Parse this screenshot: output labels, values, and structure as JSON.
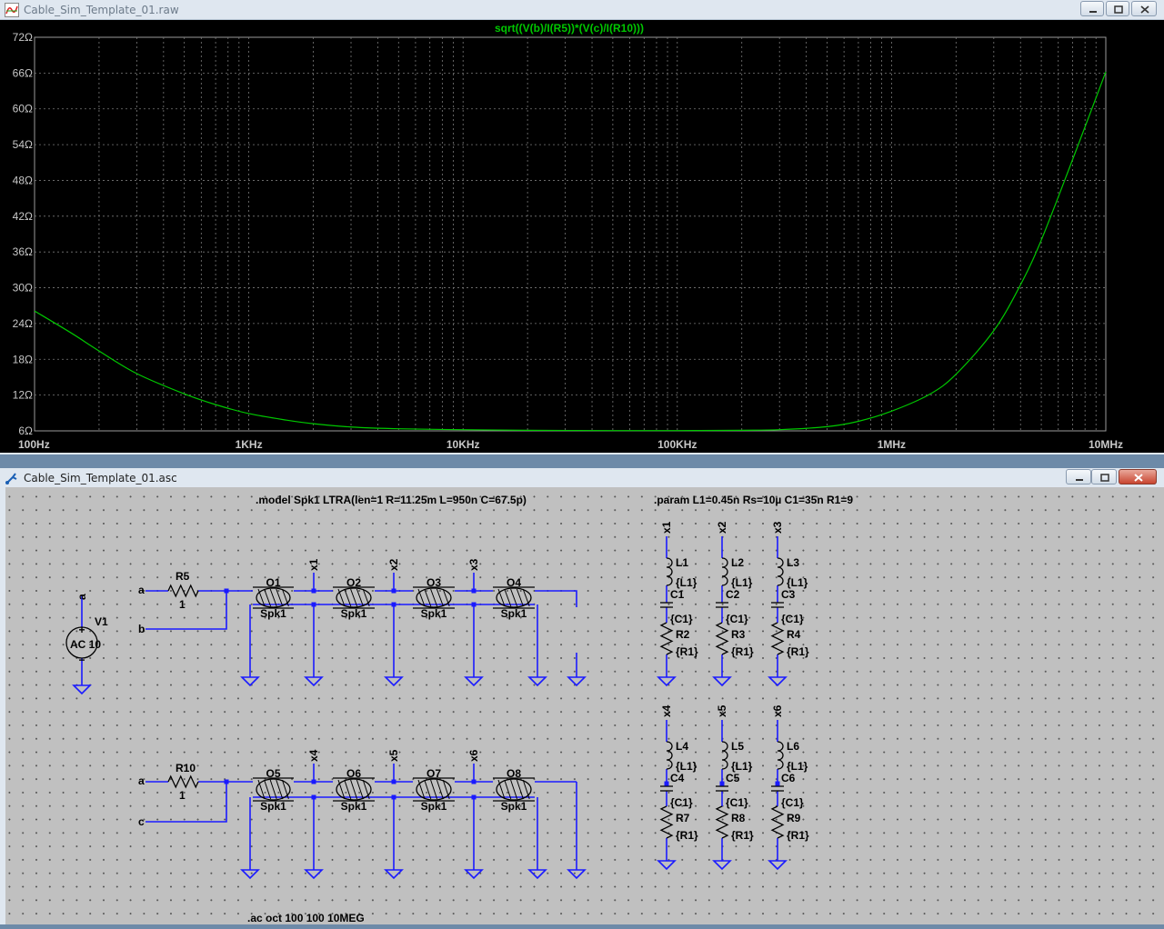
{
  "plot_window": {
    "title": "Cable_Sim_Template_01.raw"
  },
  "schematic_window": {
    "title": "Cable_Sim_Template_01.asc"
  },
  "chart_data": {
    "type": "line",
    "title": "sqrt((V(b)/I(R5))*(V(c)/I(R10)))",
    "x_scale": "log",
    "xlim": [
      100,
      10000000
    ],
    "ylim": [
      6,
      72
    ],
    "x_tick_labels": [
      "100Hz",
      "1KHz",
      "10KHz",
      "100KHz",
      "1MHz",
      "10MHz"
    ],
    "x_ticks": [
      100,
      1000,
      10000,
      100000,
      1000000,
      10000000
    ],
    "y_tick_labels": [
      "6Ω",
      "12Ω",
      "18Ω",
      "24Ω",
      "30Ω",
      "36Ω",
      "42Ω",
      "48Ω",
      "54Ω",
      "60Ω",
      "66Ω",
      "72Ω"
    ],
    "y_ticks": [
      6,
      12,
      18,
      24,
      30,
      36,
      42,
      48,
      54,
      60,
      66,
      72
    ],
    "grid": true,
    "background": "#000000",
    "trace_color": "#00c800",
    "series": [
      {
        "x": [
          100,
          150,
          200,
          300,
          500,
          700,
          1000,
          1500,
          2000,
          3000,
          5000,
          10000,
          20000,
          50000,
          100000,
          200000,
          300000,
          500000,
          700000,
          1000000,
          1500000,
          2000000,
          3000000,
          4000000,
          5000000,
          7000000,
          10000000
        ],
        "values": [
          26.1,
          22.3,
          19.4,
          15.6,
          12.2,
          10.4,
          8.9,
          7.8,
          7.2,
          6.65,
          6.35,
          6.2,
          6.1,
          6.05,
          6.05,
          6.1,
          6.2,
          6.7,
          7.6,
          9.3,
          12.1,
          15.5,
          22.8,
          30.5,
          38.0,
          51.5,
          66.2
        ]
      }
    ]
  },
  "schematic": {
    "model_directive": ".model Spk1 LTRA(len=1 R=11.25m L=950n C=67.5p)",
    "param_directive": ".param L1=0.45n Rs=10µ C1=35n R1=9",
    "ac_directive": ".ac oct 100 100 10MEG",
    "source": {
      "name": "V1",
      "value": "AC 10",
      "net": "a"
    },
    "resistor_top": {
      "name": "R5",
      "value": "1"
    },
    "resistor_bottom": {
      "name": "R10",
      "value": "1"
    },
    "net_labels": {
      "a": "a",
      "b": "b",
      "c": "c"
    },
    "lines_top": [
      "O1",
      "O2",
      "O3",
      "O4"
    ],
    "lines_bottom": [
      "O5",
      "O6",
      "O7",
      "O8"
    ],
    "line_model": "Spk1",
    "tap_labels_top": [
      "x1",
      "x2",
      "x3"
    ],
    "tap_labels_bottom": [
      "x4",
      "x5",
      "x6"
    ],
    "rlc_top": [
      {
        "tap": "x1",
        "l": "L1",
        "l_val": "{L1}",
        "c": "C1",
        "c_val": "{C1}",
        "r": "R2",
        "r_val": "{R1}"
      },
      {
        "tap": "x2",
        "l": "L2",
        "l_val": "{L1}",
        "c": "C2",
        "c_val": "{C1}",
        "r": "R3",
        "r_val": "{R1}"
      },
      {
        "tap": "x3",
        "l": "L3",
        "l_val": "{L1}",
        "c": "C3",
        "c_val": "{C1}",
        "r": "R4",
        "r_val": "{R1}"
      }
    ],
    "rlc_bottom": [
      {
        "tap": "x4",
        "l": "L4",
        "l_val": "{L1}",
        "c": "C4",
        "c_val": "{C1}",
        "r": "R7",
        "r_val": "{R1}"
      },
      {
        "tap": "x5",
        "l": "L5",
        "l_val": "{L1}",
        "c": "C5",
        "c_val": "{C1}",
        "r": "R8",
        "r_val": "{R1}"
      },
      {
        "tap": "x6",
        "l": "L6",
        "l_val": "{L1}",
        "c": "C6",
        "c_val": "{C1}",
        "r": "R9",
        "r_val": "{R1}"
      }
    ]
  }
}
